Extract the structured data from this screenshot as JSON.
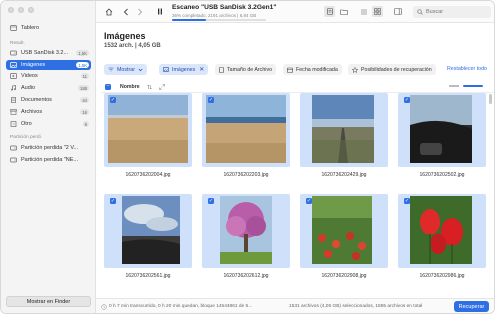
{
  "sidebar": {
    "dashboard_label": "Tablero",
    "section_results": "Result.",
    "device": {
      "label": "USB  SanDisk 3.2...",
      "count": "1,5K"
    },
    "items": [
      {
        "label": "Imágenes",
        "count": "1,5K",
        "icon": "image-icon"
      },
      {
        "label": "Videos",
        "count": "11",
        "icon": "video-icon"
      },
      {
        "label": "Audio",
        "count": "188",
        "icon": "audio-icon"
      },
      {
        "label": "Documentos",
        "count": "44",
        "icon": "document-icon"
      },
      {
        "label": "Archivos",
        "count": "16",
        "icon": "archive-icon"
      },
      {
        "label": "Otro",
        "count": "6",
        "icon": "other-icon"
      }
    ],
    "section_lost": "Partición perdi.",
    "lost_partitions": [
      {
        "label": "Partición perdida \"2 V..."
      },
      {
        "label": "Partición perdida \"NE..."
      }
    ],
    "finder_button": "Mostrar en Finder"
  },
  "toolbar": {
    "title": "Escaneo \"USB  SanDisk 3.2Gen1\"",
    "subtitle": "36% completado, 2191 archivos | 6,84 GB",
    "progress": 0.36,
    "search_placeholder": "Buscar"
  },
  "main": {
    "heading": "Imágenes",
    "subheading": "1532 arch. | 4,05 GB",
    "filters": {
      "show": "Mostrar",
      "images": "Imágenes",
      "file_size": "Tamaño de Archivo",
      "date_modified": "Fecha modificada",
      "recovery": "Posibilidades de recuperación",
      "reset": "Restablecer todo"
    },
    "list_header": {
      "name": "Nombre"
    },
    "files": [
      "1620736202004.jpg",
      "1620736202203.jpg",
      "1620736202429.jpg",
      "1620736202502.jpg",
      "1620736202561.jpg",
      "1620736202612.jpg",
      "1620736202908.jpg",
      "1620736202986.jpg"
    ]
  },
  "footer": {
    "status": "0 h 7 min transcurrido, 0 h 20 min quedan, bloque 14544861 de 5...",
    "selection": "1531 archivos (4,05 GB) seleccionados, 1865 archivos en total",
    "recover_button": "Recuperar"
  },
  "colors": {
    "accent": "#2f6fe4",
    "selection": "#cfe0fb"
  }
}
